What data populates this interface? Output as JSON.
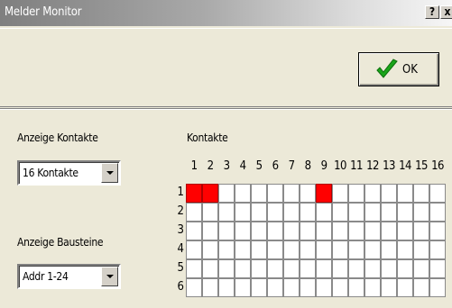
{
  "window": {
    "title": "Melder Monitor",
    "help_label": "?",
    "close_label": "x"
  },
  "ok_button": {
    "label": "OK",
    "icon": "checkmark-icon",
    "icon_color": "#1aa51a"
  },
  "kontakte_select": {
    "label": "Anzeige Kontakte",
    "value": "16 Kontakte"
  },
  "bausteine_select": {
    "label": "Anzeige Bausteine",
    "value": "Addr 1-24"
  },
  "grid": {
    "title": "Kontakte",
    "columns": [
      "1",
      "2",
      "3",
      "4",
      "5",
      "6",
      "7",
      "8",
      "9",
      "10",
      "11",
      "12",
      "13",
      "14",
      "15",
      "16"
    ],
    "rows": [
      "1",
      "2",
      "3",
      "4",
      "5",
      "6"
    ],
    "active_color": "#ff0000",
    "active_cells": [
      {
        "row": 1,
        "col": 1
      },
      {
        "row": 1,
        "col": 2
      },
      {
        "row": 1,
        "col": 9
      }
    ]
  }
}
